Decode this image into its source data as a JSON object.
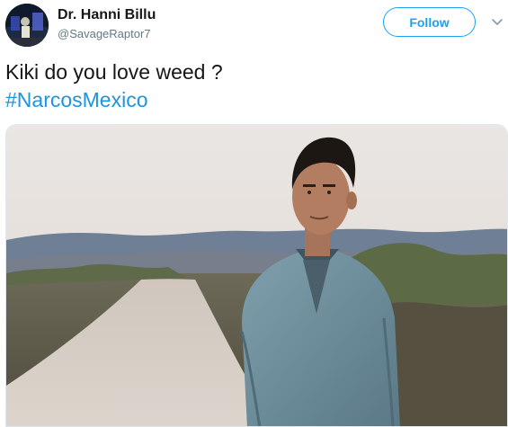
{
  "user": {
    "display_name": "Dr. Hanni Billu",
    "handle": "@SavageRaptor7",
    "avatar_icon": "avatar-image"
  },
  "actions": {
    "follow_label": "Follow",
    "more_icon": "chevron-down-icon"
  },
  "tweet": {
    "text": "Kiki do you love weed ?",
    "hashtag": "#NarcosMexico"
  },
  "media": {
    "type": "photo",
    "icon": "photo-image"
  },
  "colors": {
    "accent": "#1da1f2",
    "link": "#1b95e0",
    "text": "#14171a",
    "secondary": "#657786"
  }
}
